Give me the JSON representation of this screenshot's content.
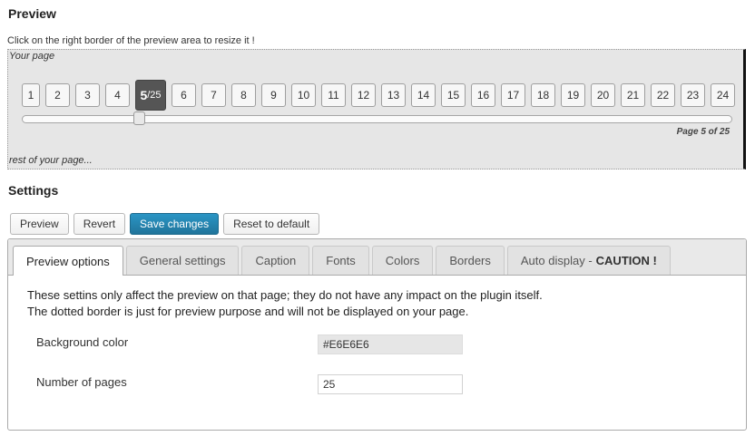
{
  "preview": {
    "title": "Preview",
    "hint": "Click on the right border of the preview area to resize it !",
    "your_page": "Your page",
    "rest_of_page": "rest of your page...",
    "pages_before": [
      "1",
      "2",
      "3",
      "4"
    ],
    "current_page": "5",
    "current_total": "/25",
    "pages_after": [
      "6",
      "7",
      "8",
      "9",
      "10",
      "11",
      "12",
      "13",
      "14",
      "15",
      "16",
      "17",
      "18",
      "19",
      "20",
      "21",
      "22",
      "23",
      "24"
    ],
    "slider_position": 0.16,
    "page_count": "Page 5 of 25"
  },
  "settings": {
    "title": "Settings",
    "buttons": {
      "preview": "Preview",
      "revert": "Revert",
      "save": "Save changes",
      "reset": "Reset to default"
    },
    "tabs": {
      "preview_options": "Preview options",
      "general": "General settings",
      "caption": "Caption",
      "fonts": "Fonts",
      "colors": "Colors",
      "borders": "Borders",
      "auto_display": "Auto display -",
      "caution": "CAUTION !"
    },
    "description_line1": "These settins only affect the preview on that page; they do not have any impact on the plugin itself.",
    "description_line2": "The dotted border is just for preview purpose and will not be displayed on your page.",
    "background_color_label": "Background color",
    "background_color_value": "#E6E6E6",
    "pages_label": "Number of pages",
    "pages_value": "25"
  },
  "colors": {
    "primary_button": "#21759b",
    "preview_background": "#E6E6E6",
    "current_page_button": "#555555"
  }
}
